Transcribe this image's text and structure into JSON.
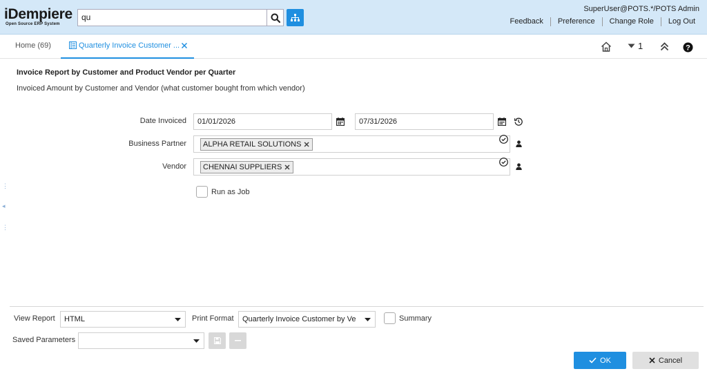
{
  "header": {
    "logo_main": "iDempiere",
    "logo_sub": "Open Source ERP System",
    "search_value": "qu",
    "user": "SuperUser@POTS.*/POTS Admin",
    "links": [
      "Feedback",
      "Preference",
      "Change Role",
      "Log Out"
    ]
  },
  "tabs": {
    "home": "Home (69)",
    "active": "Quarterly Invoice Customer ..."
  },
  "toolbar": {
    "window_count": "1"
  },
  "form": {
    "title": "Invoice Report by Customer and Product Vendor per Quarter",
    "description": "Invoiced Amount by Customer and Vendor (what customer bought from which vendor)",
    "date_invoiced_label": "Date Invoiced",
    "date_from": "01/01/2026",
    "date_to": "07/31/2026",
    "bpartner_label": "Business Partner",
    "bpartner_value": "ALPHA RETAIL SOLUTIONS",
    "vendor_label": "Vendor",
    "vendor_value": "CHENNAI SUPPLIERS",
    "run_as_job_label": "Run as Job"
  },
  "footer": {
    "view_report_label": "View Report",
    "view_report_value": "HTML",
    "print_format_label": "Print Format",
    "print_format_value": "Quarterly Invoice Customer by Ve",
    "summary_label": "Summary",
    "saved_params_label": "Saved Parameters",
    "saved_params_value": "",
    "ok_label": "OK",
    "cancel_label": "Cancel"
  },
  "colors": {
    "accent": "#1f8fe0",
    "header_bg": "#d4e8f8"
  }
}
